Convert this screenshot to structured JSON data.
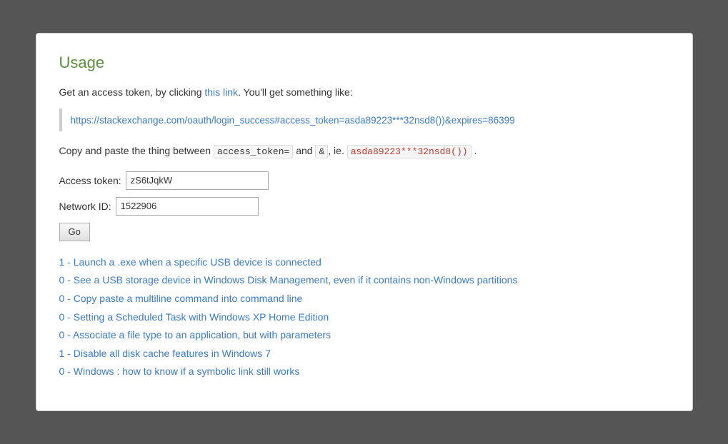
{
  "card": {
    "title": "Usage",
    "intro": {
      "text_before_link": "Get an access token, by clicking ",
      "link_text": "this link",
      "link_href": "#",
      "text_after_link": ". You'll get something like:"
    },
    "example_url": "https://stackexchange.com/oauth/login_success#access_token=asda89223***32nsd8())&expires=86399",
    "instruction": {
      "prefix": "Copy and paste the thing between ",
      "code1": "access_token=",
      "middle": " and ",
      "code2": "&",
      "suffix": ", ie. ",
      "code3": "asda89223***32nsd8())",
      "end": " ."
    },
    "form": {
      "access_token_label": "Access token:",
      "access_token_value": "zS6tJqkW",
      "network_id_label": "Network ID:",
      "network_id_value": "1522906",
      "go_button_label": "Go"
    },
    "results": [
      {
        "vote": "1",
        "title": "Launch a .exe when a specific USB device is connected",
        "href": "#"
      },
      {
        "vote": "0",
        "title": "See a USB storage device in Windows Disk Management, even if it contains non-Windows partitions",
        "href": "#"
      },
      {
        "vote": "0",
        "title": "Copy paste a multiline command into command line",
        "href": "#"
      },
      {
        "vote": "0",
        "title": "Setting a Scheduled Task with Windows XP Home Edition",
        "href": "#"
      },
      {
        "vote": "0",
        "title": "Associate a file type to an application, but with parameters",
        "href": "#"
      },
      {
        "vote": "1",
        "title": "Disable all disk cache features in Windows 7",
        "href": "#"
      },
      {
        "vote": "0",
        "title": "Windows : how to know if a symbolic link still works",
        "href": "#"
      }
    ]
  }
}
